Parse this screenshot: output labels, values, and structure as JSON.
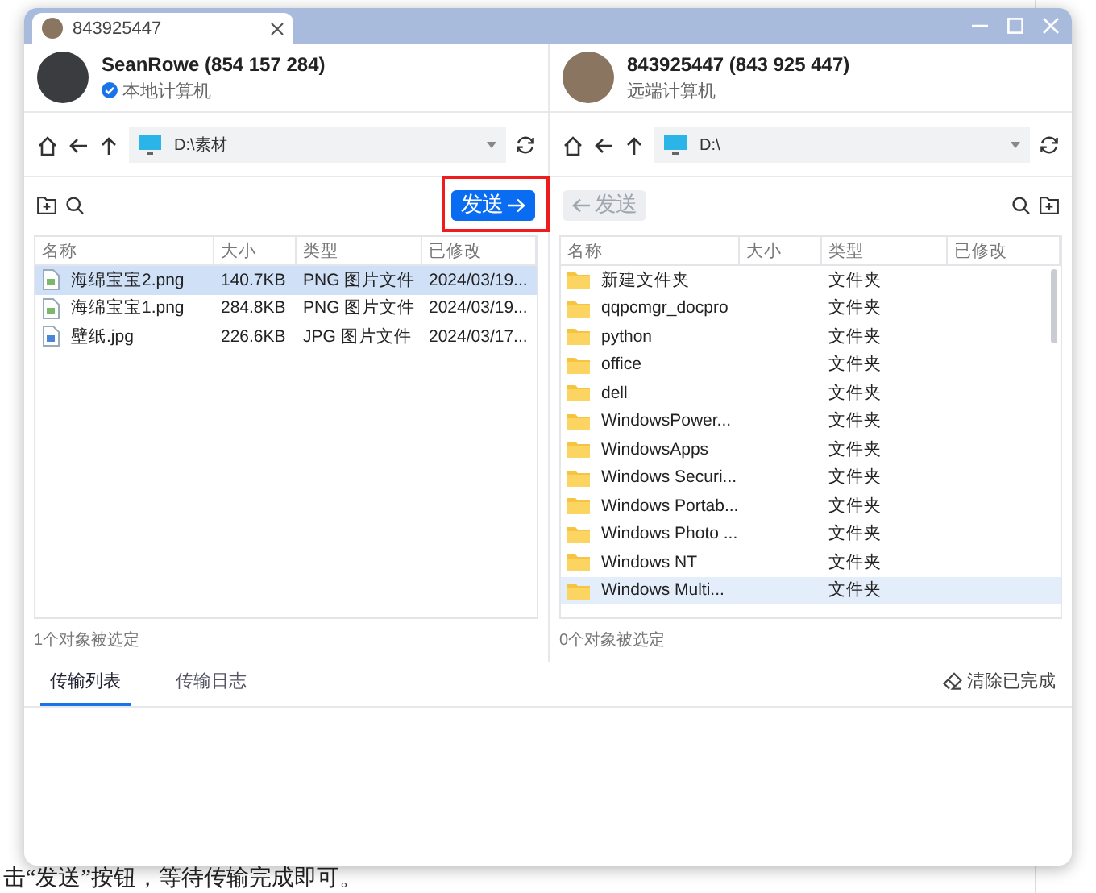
{
  "background_caption": "击“发送”按钮，等待传输完成即可。",
  "window": {
    "tab_title": "843925447"
  },
  "panes": [
    {
      "kind": "local",
      "name": "SeanRowe (854 157 284)",
      "subtitle": "本地计算机",
      "verified": true,
      "path": "D:\\素材",
      "send_label": "发送",
      "send_enabled": true,
      "send_highlighted": true,
      "columns": [
        "名称",
        "大小",
        "类型",
        "已修改"
      ],
      "rows": [
        {
          "kind": "png",
          "name": "海绵宝宝2.png",
          "size": "140.7KB",
          "type": "PNG 图片文件",
          "modified": "2024/03/19...",
          "selected": true
        },
        {
          "kind": "png",
          "name": "海绵宝宝1.png",
          "size": "284.8KB",
          "type": "PNG 图片文件",
          "modified": "2024/03/19...",
          "selected": false
        },
        {
          "kind": "jpg",
          "name": "壁纸.jpg",
          "size": "226.6KB",
          "type": "JPG 图片文件",
          "modified": "2024/03/17...",
          "selected": false
        }
      ],
      "status": "1个对象被选定"
    },
    {
      "kind": "remote",
      "name": "843925447 (843 925 447)",
      "subtitle": "远端计算机",
      "verified": false,
      "path": "D:\\",
      "send_label": "发送",
      "send_enabled": false,
      "send_highlighted": false,
      "columns": [
        "名称",
        "大小",
        "类型",
        "已修改"
      ],
      "rows": [
        {
          "kind": "folder",
          "name": "新建文件夹",
          "type": "文件夹",
          "selected": false
        },
        {
          "kind": "folder",
          "name": "qqpcmgr_docpro",
          "type": "文件夹",
          "selected": false
        },
        {
          "kind": "folder",
          "name": "python",
          "type": "文件夹",
          "selected": false
        },
        {
          "kind": "folder",
          "name": "office",
          "type": "文件夹",
          "selected": false
        },
        {
          "kind": "folder",
          "name": "dell",
          "type": "文件夹",
          "selected": false
        },
        {
          "kind": "folder",
          "name": "WindowsPower...",
          "type": "文件夹",
          "selected": false
        },
        {
          "kind": "folder",
          "name": "WindowsApps",
          "type": "文件夹",
          "selected": false
        },
        {
          "kind": "folder",
          "name": "Windows Securi...",
          "type": "文件夹",
          "selected": false
        },
        {
          "kind": "folder",
          "name": "Windows Portab...",
          "type": "文件夹",
          "selected": false
        },
        {
          "kind": "folder",
          "name": "Windows Photo ...",
          "type": "文件夹",
          "selected": false
        },
        {
          "kind": "folder",
          "name": "Windows NT",
          "type": "文件夹",
          "selected": false
        },
        {
          "kind": "folder",
          "name": "Windows Multi...",
          "type": "文件夹",
          "selected": true
        }
      ],
      "status": "0个对象被选定"
    }
  ],
  "transfer_tabs": [
    {
      "label": "传输列表",
      "selected": true
    },
    {
      "label": "传输日志",
      "selected": false
    }
  ],
  "clear_button": "清除已完成"
}
